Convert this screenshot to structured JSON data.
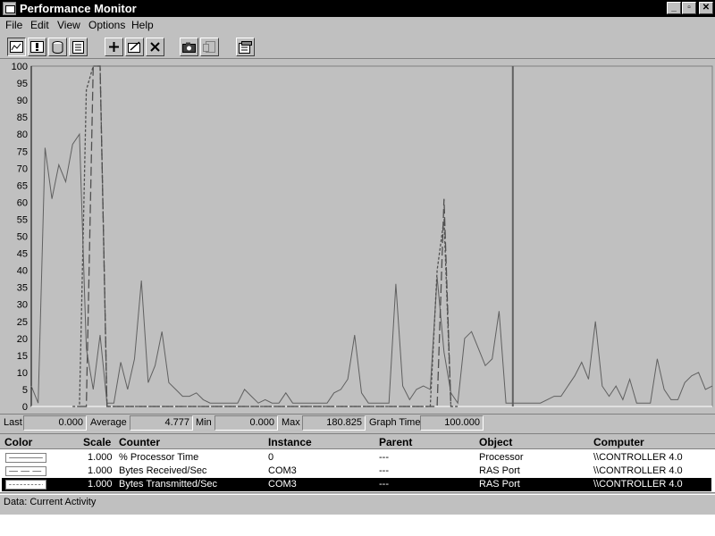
{
  "window": {
    "title": "Performance Monitor",
    "minimize": "_",
    "restore": "▫",
    "close": "✕"
  },
  "menu": [
    "File",
    "Edit",
    "View",
    "Options",
    "Help"
  ],
  "toolbar": [
    {
      "name": "chart-view-icon"
    },
    {
      "name": "alert-view-icon"
    },
    {
      "name": "log-view-icon"
    },
    {
      "name": "report-view-icon"
    },
    {
      "name": "add-counter-icon"
    },
    {
      "name": "edit-counter-icon"
    },
    {
      "name": "delete-counter-icon"
    },
    {
      "name": "update-now-icon"
    },
    {
      "name": "place-bookmark-icon"
    },
    {
      "name": "options-icon"
    }
  ],
  "chart_data": {
    "type": "line",
    "ylim": [
      0,
      100
    ],
    "y_ticks": [
      "100",
      "95",
      "90",
      "85",
      "80",
      "75",
      "70",
      "65",
      "60",
      "55",
      "50",
      "45",
      "40",
      "35",
      "30",
      "25",
      "20",
      "15",
      "10",
      "5",
      "0"
    ],
    "x_count": 100,
    "current_position": 70,
    "series": [
      {
        "name": "% Processor Time",
        "style": "solid",
        "values": [
          6,
          1,
          76,
          61,
          71,
          66,
          77,
          80,
          17,
          5,
          21,
          1,
          1,
          13,
          5,
          14,
          37,
          7,
          12,
          22,
          7,
          5,
          3,
          3,
          4,
          2,
          1,
          1,
          1,
          1,
          1,
          5,
          3,
          1,
          2,
          1,
          1,
          4,
          1,
          1,
          1,
          1,
          1,
          1,
          4,
          5,
          8,
          21,
          4,
          1,
          1,
          1,
          1,
          36,
          6,
          2,
          5,
          6,
          5,
          38,
          16,
          4,
          1,
          20,
          22,
          17,
          12,
          14,
          28,
          1,
          1,
          1,
          1,
          1,
          1,
          2,
          3,
          3,
          6,
          9,
          13,
          8,
          25,
          6,
          3,
          6,
          2,
          8,
          1,
          1,
          1,
          14,
          5,
          2,
          2,
          7,
          9,
          10,
          5,
          6
        ]
      },
      {
        "name": "Bytes Received/Sec",
        "style": "long-dash",
        "points": [
          [
            7,
            0
          ],
          [
            8,
            0
          ],
          [
            9,
            100
          ],
          [
            10,
            100
          ],
          [
            11,
            0
          ],
          [
            12,
            0
          ],
          [
            59,
            0
          ],
          [
            60,
            61
          ],
          [
            61,
            0
          ]
        ]
      },
      {
        "name": "Bytes Transmitted/Sec",
        "style": "short-dash",
        "points": [
          [
            6,
            0
          ],
          [
            7,
            0
          ],
          [
            8,
            93
          ],
          [
            9,
            100
          ],
          [
            10,
            100
          ],
          [
            11,
            0
          ],
          [
            12,
            0
          ],
          [
            58,
            0
          ],
          [
            59,
            40
          ],
          [
            60,
            55
          ],
          [
            61,
            0
          ],
          [
            62,
            0
          ]
        ]
      }
    ]
  },
  "stats": {
    "last_label": "Last",
    "last": "0.000",
    "average_label": "Average",
    "average": "4.777",
    "min_label": "Min",
    "min": "0.000",
    "max_label": "Max",
    "max": "180.825",
    "graph_time_label": "Graph Time",
    "graph_time": "100.000"
  },
  "legend": {
    "headers": {
      "color": "Color",
      "scale": "Scale",
      "counter": "Counter",
      "instance": "Instance",
      "parent": "Parent",
      "object": "Object",
      "computer": "Computer"
    },
    "rows": [
      {
        "scale": "1.000",
        "counter": "% Processor Time",
        "instance": "0",
        "parent": "---",
        "object": "Processor",
        "computer": "\\\\CONTROLLER 4.0"
      },
      {
        "scale": "1.000",
        "counter": "Bytes Received/Sec",
        "instance": "COM3",
        "parent": "---",
        "object": "RAS Port",
        "computer": "\\\\CONTROLLER 4.0"
      },
      {
        "scale": "1.000",
        "counter": "Bytes Transmitted/Sec",
        "instance": "COM3",
        "parent": "---",
        "object": "RAS Port",
        "computer": "\\\\CONTROLLER 4.0"
      }
    ]
  },
  "status": "Data: Current Activity"
}
